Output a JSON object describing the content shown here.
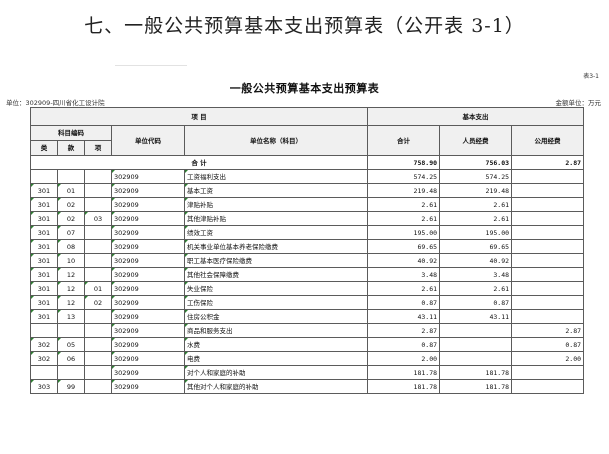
{
  "page_title": "七、一般公共预算基本支出预算表（公开表 3-1）",
  "table_no": "表3-1",
  "table_title": "一般公共预算基本支出预算表",
  "unit_left": "单位：302909-四川省化工设计院",
  "unit_right": "金额单位：万元",
  "headers": {
    "item": "项 目",
    "basic": "基本支出",
    "subject_code": "科目编码",
    "class": "类",
    "section": "款",
    "item_col": "项",
    "unit_code": "单位代码",
    "unit_name": "单位名称（科目）",
    "total": "合计",
    "personnel": "人员经费",
    "public": "公用经费"
  },
  "total_row": {
    "label": "合 计",
    "total": "758.90",
    "personnel": "756.03",
    "public": "2.87"
  },
  "rows": [
    {
      "c1": "",
      "c2": "",
      "c3": "",
      "unit": "302909",
      "name": "工资福利支出",
      "total": "574.25",
      "personnel": "574.25",
      "public": ""
    },
    {
      "c1": "301",
      "c2": "01",
      "c3": "",
      "unit": "302909",
      "name": "基本工资",
      "total": "219.48",
      "personnel": "219.48",
      "public": ""
    },
    {
      "c1": "301",
      "c2": "02",
      "c3": "",
      "unit": "302909",
      "name": "津贴补贴",
      "total": "2.61",
      "personnel": "2.61",
      "public": ""
    },
    {
      "c1": "301",
      "c2": "02",
      "c3": "03",
      "unit": "302909",
      "name": " 其他津贴补贴",
      "total": "2.61",
      "personnel": "2.61",
      "public": ""
    },
    {
      "c1": "301",
      "c2": "07",
      "c3": "",
      "unit": "302909",
      "name": "绩效工资",
      "total": "195.00",
      "personnel": "195.00",
      "public": ""
    },
    {
      "c1": "301",
      "c2": "08",
      "c3": "",
      "unit": "302909",
      "name": "机关事业单位基本养老保险缴费",
      "total": "69.65",
      "personnel": "69.65",
      "public": ""
    },
    {
      "c1": "301",
      "c2": "10",
      "c3": "",
      "unit": "302909",
      "name": "职工基本医疗保险缴费",
      "total": "40.92",
      "personnel": "40.92",
      "public": ""
    },
    {
      "c1": "301",
      "c2": "12",
      "c3": "",
      "unit": "302909",
      "name": "其他社会保障缴费",
      "total": "3.48",
      "personnel": "3.48",
      "public": ""
    },
    {
      "c1": "301",
      "c2": "12",
      "c3": "01",
      "unit": "302909",
      "name": " 失业保险",
      "total": "2.61",
      "personnel": "2.61",
      "public": ""
    },
    {
      "c1": "301",
      "c2": "12",
      "c3": "02",
      "unit": "302909",
      "name": " 工伤保险",
      "total": "0.87",
      "personnel": "0.87",
      "public": ""
    },
    {
      "c1": "301",
      "c2": "13",
      "c3": "",
      "unit": "302909",
      "name": "住房公积金",
      "total": "43.11",
      "personnel": "43.11",
      "public": ""
    },
    {
      "c1": "",
      "c2": "",
      "c3": "",
      "unit": "302909",
      "name": "商品和服务支出",
      "total": "2.87",
      "personnel": "",
      "public": "2.87"
    },
    {
      "c1": "302",
      "c2": "05",
      "c3": "",
      "unit": "302909",
      "name": "水费",
      "total": "0.87",
      "personnel": "",
      "public": "0.87"
    },
    {
      "c1": "302",
      "c2": "06",
      "c3": "",
      "unit": "302909",
      "name": "电费",
      "total": "2.00",
      "personnel": "",
      "public": "2.00"
    },
    {
      "c1": "",
      "c2": "",
      "c3": "",
      "unit": "302909",
      "name": "对个人和家庭的补助",
      "total": "181.78",
      "personnel": "181.78",
      "public": ""
    },
    {
      "c1": "303",
      "c2": "99",
      "c3": "",
      "unit": "302909",
      "name": "其他对个人和家庭的补助",
      "total": "181.78",
      "personnel": "181.78",
      "public": ""
    }
  ]
}
